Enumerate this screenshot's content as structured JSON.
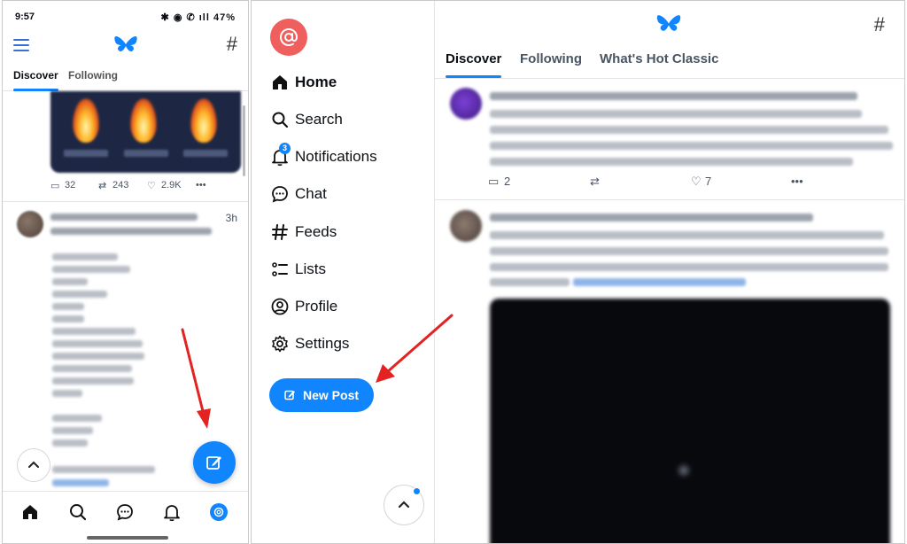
{
  "mobile": {
    "status_bar": {
      "time": "9:57",
      "icons": "✱ ◉ ✆ ıll 47%"
    },
    "tabs": [
      {
        "label": "Discover"
      },
      {
        "label": "Following"
      }
    ],
    "post1_actions": {
      "replies": "32",
      "reposts": "243",
      "likes": "2.9K",
      "more": "•••"
    },
    "post2": {
      "time": "3h"
    },
    "scroll_up_icon": "chevron-up-icon",
    "compose_icon": "compose-icon",
    "bottom_nav": [
      "home-icon",
      "search-icon",
      "chat-icon",
      "bell-icon",
      "avatar-icon"
    ]
  },
  "desktop": {
    "nav": [
      {
        "label": "Home"
      },
      {
        "label": "Search"
      },
      {
        "label": "Notifications",
        "badge": "3"
      },
      {
        "label": "Chat"
      },
      {
        "label": "Feeds"
      },
      {
        "label": "Lists"
      },
      {
        "label": "Profile"
      },
      {
        "label": "Settings"
      }
    ],
    "new_post": "New Post",
    "tabs": [
      {
        "label": "Discover"
      },
      {
        "label": "Following"
      },
      {
        "label": "What's Hot Classic"
      }
    ],
    "post1_actions": {
      "replies": "2",
      "likes": "7",
      "more": "•••"
    }
  },
  "colors": {
    "accent": "#1185fe",
    "avatar": "#ef5f5d",
    "annotation_arrow": "#e32222"
  }
}
